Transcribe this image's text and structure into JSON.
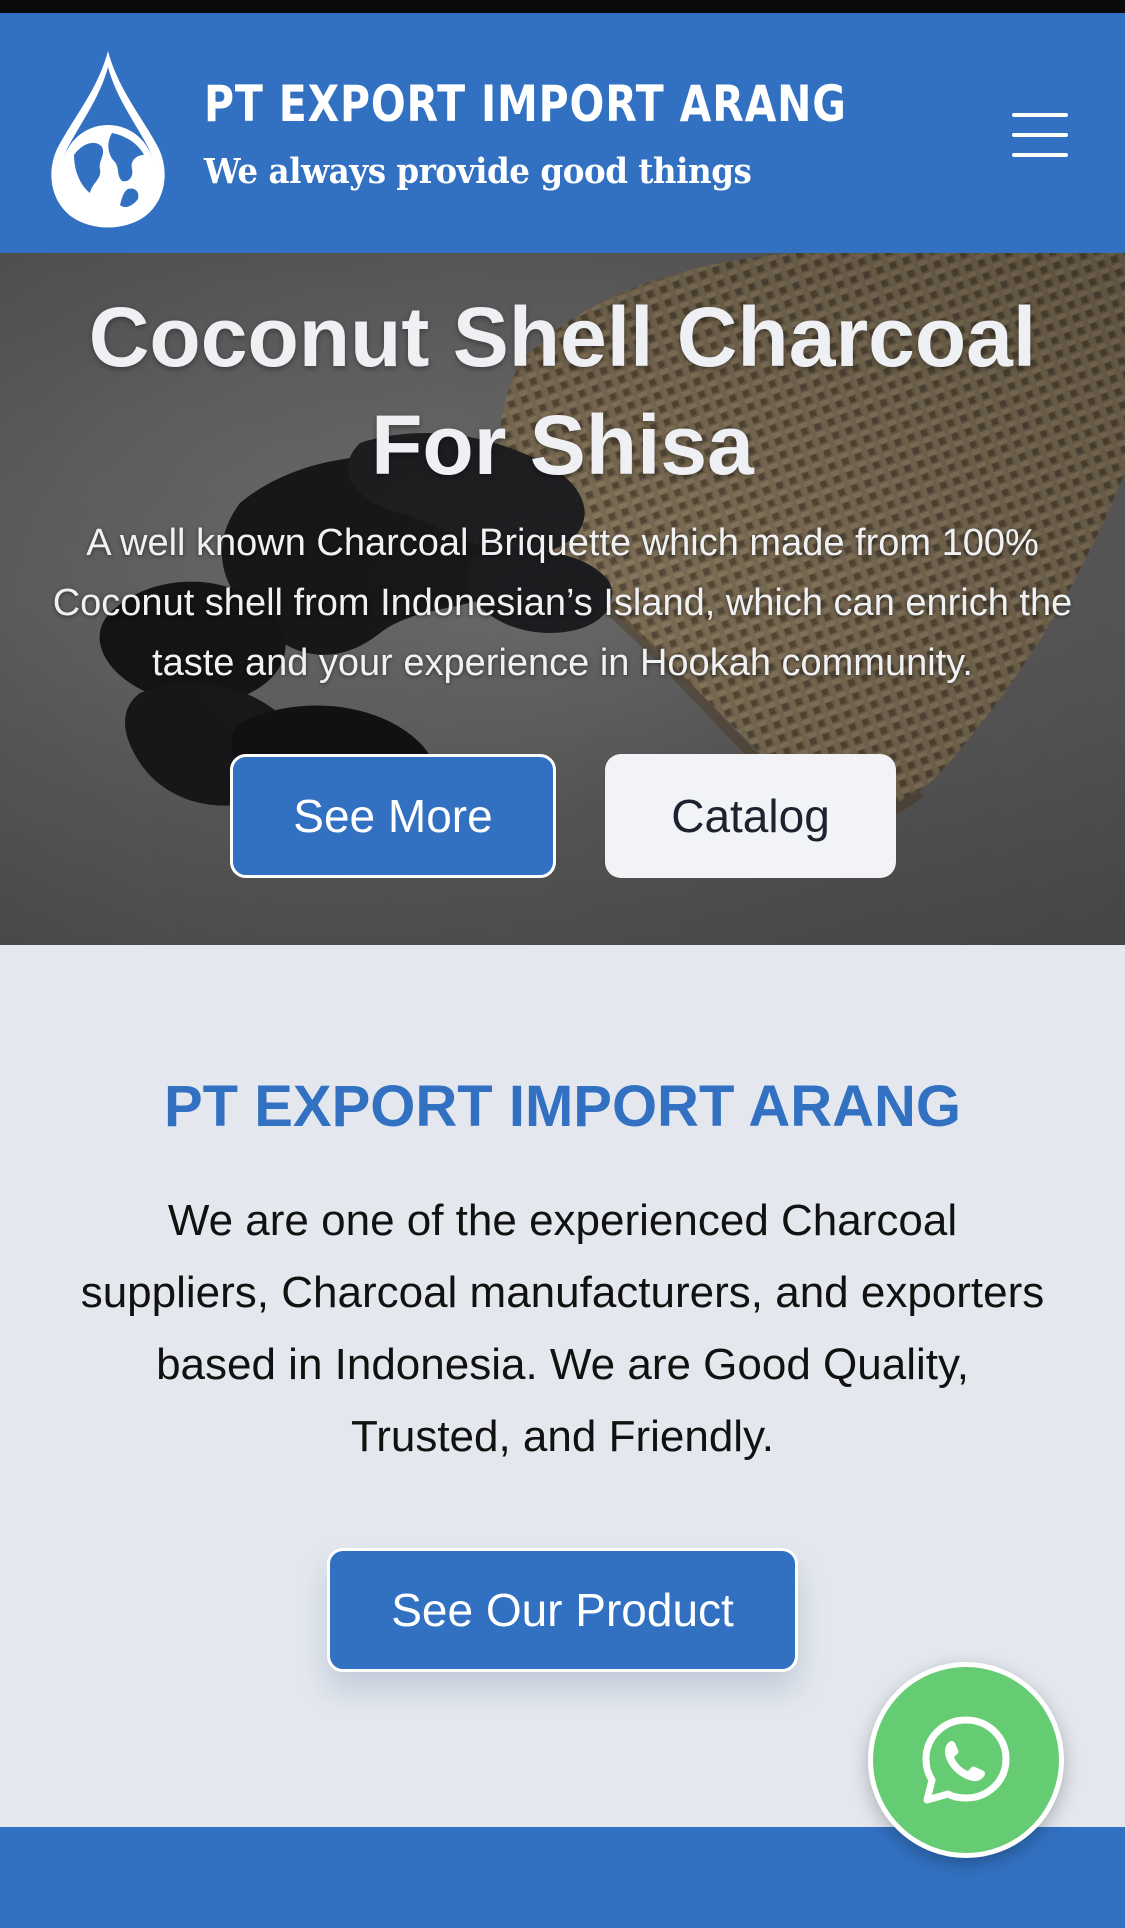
{
  "header": {
    "brand_name": "PT EXPORT IMPORT ARANG",
    "tagline": "We always provide good things",
    "logo_icon": "water-drop-globe-icon",
    "menu_icon": "hamburger-menu-icon"
  },
  "hero": {
    "title": "Coconut Shell Charcoal For Shisa",
    "description": "A well known Charcoal Briquette which made from 100% Coconut shell from Indonesian’s Island, which can enrich the taste and your experience in Hookah community.",
    "buttons": {
      "see_more": "See More",
      "catalog": "Catalog"
    }
  },
  "about": {
    "title": "PT EXPORT IMPORT ARANG",
    "text": "We are one of the experienced Charcoal suppliers, Charcoal manufacturers, and exporters based in Indonesia. We are Good Quality, Trusted, and Friendly.",
    "button": "See Our Product"
  },
  "floating": {
    "whatsapp_icon": "whatsapp-icon"
  },
  "colors": {
    "brand_blue": "#3271c2",
    "page_background": "#e4e8ee",
    "whatsapp_green": "#66cc73"
  }
}
